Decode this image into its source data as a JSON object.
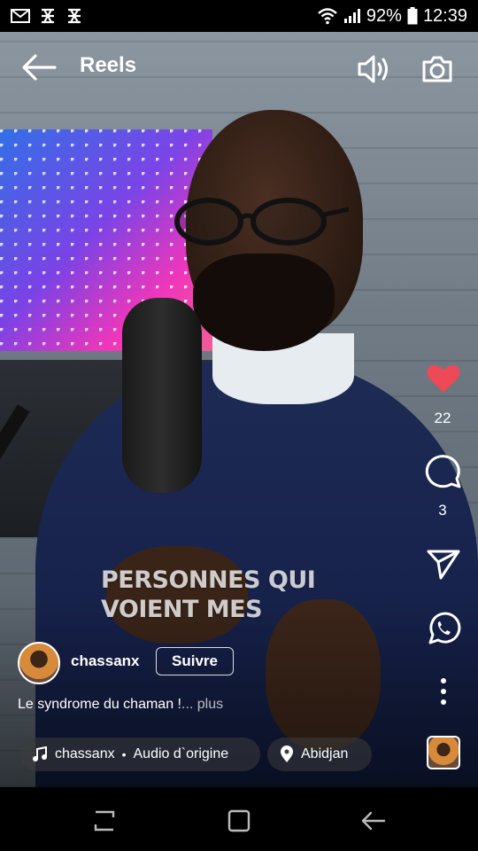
{
  "status_bar": {
    "battery": "92%",
    "time": "12:39",
    "notification_icons": [
      "gmail-icon",
      "tracker-icon",
      "tracker-icon"
    ]
  },
  "header": {
    "title": "Reels",
    "back_icon": "arrow-left-icon",
    "sound_icon": "speaker-icon",
    "camera_icon": "camera-icon"
  },
  "video": {
    "caption_lines": [
      "PERSONNES QUI",
      "VOIENT MES"
    ]
  },
  "actions": {
    "likes": "22",
    "comments": "3",
    "like_color": "#ed4956"
  },
  "post": {
    "username": "chassanx",
    "follow_label": "Suivre",
    "description": "Le syndrome du chaman !",
    "more_label": "... plus",
    "audio_user": "chassanx",
    "audio_name": "Audio d`origine",
    "location": "Abidjan"
  }
}
